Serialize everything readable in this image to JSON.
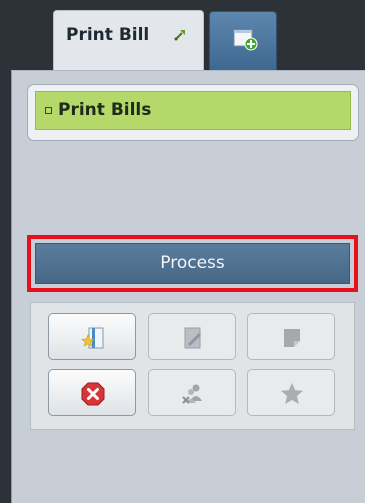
{
  "tabs": [
    {
      "label": "Print Bill",
      "icon": "pin-icon",
      "active": true
    },
    {
      "label": "",
      "icon": "add-tab-icon",
      "active": false
    }
  ],
  "panel": {
    "list": {
      "items": [
        {
          "label": "Print Bills",
          "selected": true
        }
      ]
    },
    "process_label": "Process",
    "tools": [
      {
        "icon": "notebook-star-icon",
        "enabled": true
      },
      {
        "icon": "edit-document-icon",
        "enabled": false
      },
      {
        "icon": "note-icon",
        "enabled": false
      },
      {
        "icon": "delete-icon",
        "enabled": true
      },
      {
        "icon": "remove-people-icon",
        "enabled": false
      },
      {
        "icon": "star-icon",
        "enabled": false
      }
    ]
  },
  "colors": {
    "selected_item": "#b4d96a",
    "process_bar": "#4f7191",
    "highlight": "#e8101a"
  }
}
